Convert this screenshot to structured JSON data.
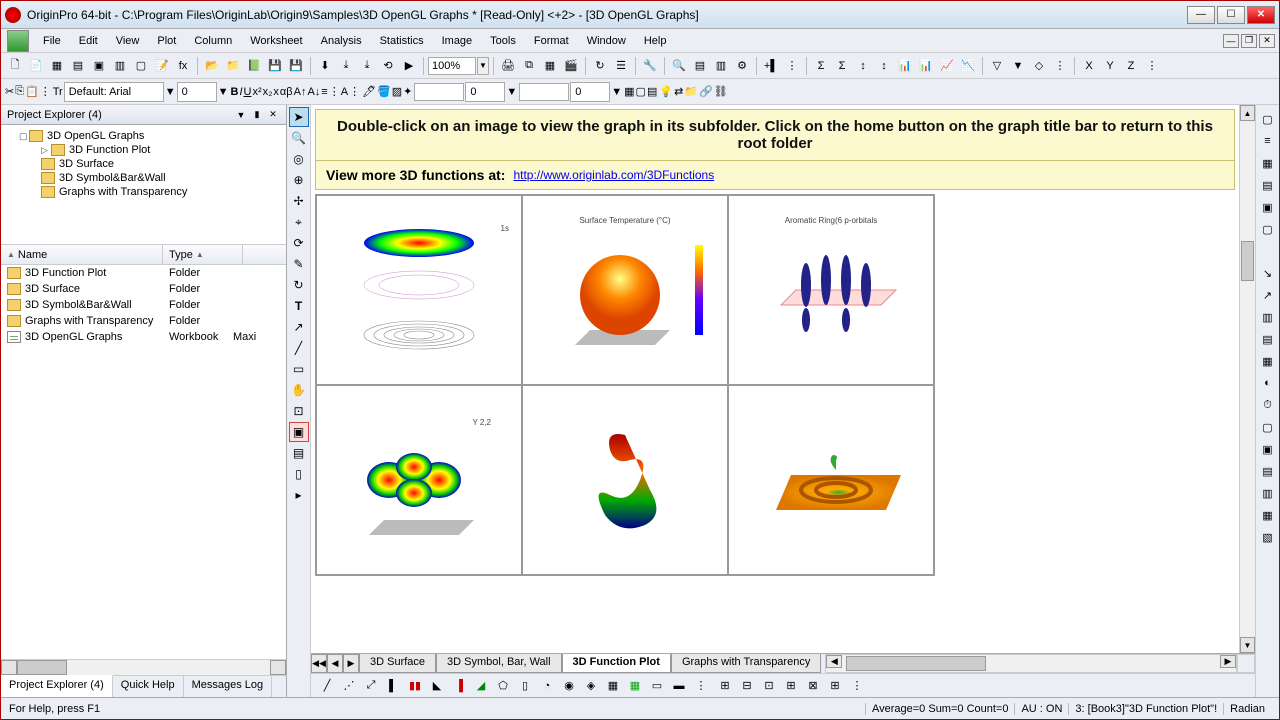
{
  "title": "OriginPro 64-bit - C:\\Program Files\\OriginLab\\Origin9\\Samples\\3D OpenGL Graphs * [Read-Only] <+2> - [3D OpenGL Graphs]",
  "menu": [
    "File",
    "Edit",
    "View",
    "Plot",
    "Column",
    "Worksheet",
    "Analysis",
    "Statistics",
    "Image",
    "Tools",
    "Format",
    "Window",
    "Help"
  ],
  "zoom": "100%",
  "font_name": "Default: Arial",
  "font_size": "0",
  "line_width": "0",
  "num2": "0",
  "project_explorer": {
    "title": "Project Explorer (4)",
    "tree": [
      {
        "level": 1,
        "label": "3D OpenGL Graphs",
        "expanded": true
      },
      {
        "level": 2,
        "label": "3D Function Plot"
      },
      {
        "level": 2,
        "label": "3D Surface"
      },
      {
        "level": 2,
        "label": "3D Symbol&Bar&Wall"
      },
      {
        "level": 2,
        "label": "Graphs with Transparency"
      }
    ],
    "columns": [
      {
        "label": "Name",
        "width": 162,
        "arrow": "▲"
      },
      {
        "label": "Type",
        "width": 80,
        "arrow": "▲"
      }
    ],
    "items": [
      {
        "name": "3D Function Plot",
        "type": "Folder",
        "icon": "folder"
      },
      {
        "name": "3D Surface",
        "type": "Folder",
        "icon": "folder"
      },
      {
        "name": "3D Symbol&Bar&Wall",
        "type": "Folder",
        "icon": "folder"
      },
      {
        "name": "Graphs with Transparency",
        "type": "Folder",
        "icon": "folder"
      },
      {
        "name": "3D OpenGL Graphs",
        "type": "Workbook",
        "icon": "wb",
        "extra": "Maxi"
      }
    ],
    "tabs": [
      "Project Explorer (4)",
      "Quick Help",
      "Messages Log"
    ]
  },
  "banner": {
    "text": "Double-click on an image to view the graph in its subfolder. Click on the home button on the graph title bar to return to this root folder",
    "link_label": "View more 3D functions at:",
    "link_url": "http://www.originlab.com/3DFunctions"
  },
  "thumbnails": [
    {
      "title": "1s"
    },
    {
      "title": "Surface Temperature (°C)"
    },
    {
      "title": "Aromatic Ring(6 p-orbitals"
    },
    {
      "title": "Y 2,2"
    },
    {
      "title": ""
    },
    {
      "title": ""
    }
  ],
  "sheet_tabs": [
    "3D Surface",
    "3D Symbol, Bar, Wall",
    "3D Function Plot",
    "Graphs with Transparency"
  ],
  "sheet_active": 2,
  "status": {
    "help": "For Help, press F1",
    "stats": "Average=0 Sum=0 Count=0",
    "au": "AU : ON",
    "book": "3: [Book3]\"3D Function Plot\"!",
    "angle": "Radian"
  }
}
